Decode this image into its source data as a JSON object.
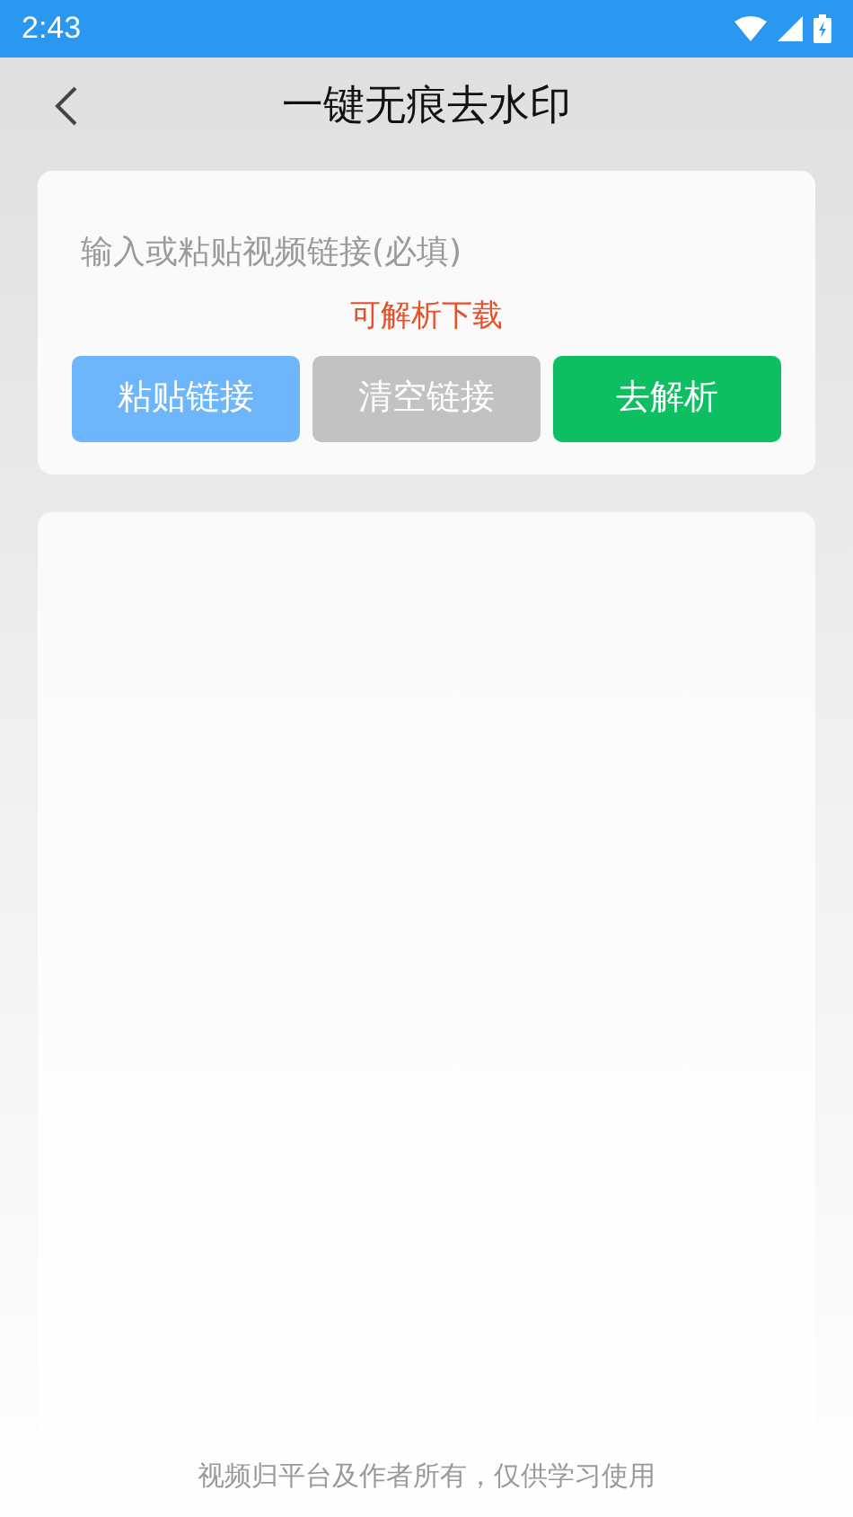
{
  "status_bar": {
    "time": "2:43"
  },
  "header": {
    "title": "一键无痕去水印"
  },
  "link_input": {
    "placeholder": "输入或粘贴视频链接(必填)"
  },
  "status_text": "可解析下载",
  "buttons": [
    {
      "label": "粘贴链接",
      "kind": "paste"
    },
    {
      "label": "清空链接",
      "kind": "clear"
    },
    {
      "label": "去解析",
      "kind": "parse"
    }
  ],
  "footer": "视频归平台及作者所有，仅供学习使用"
}
